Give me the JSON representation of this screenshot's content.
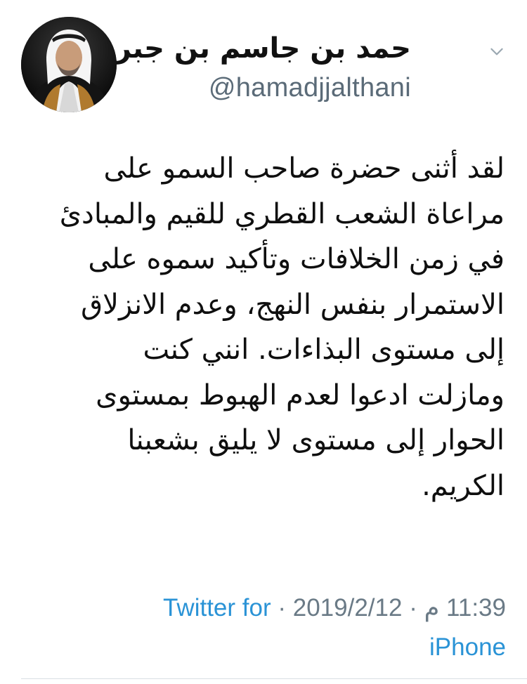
{
  "author": {
    "display_name": "حمد بن جاسم بن جبر",
    "handle": "@hamadjjalthani",
    "verified": true,
    "avatar": "profile-photo"
  },
  "tweet": {
    "lines": [
      "لقد أثنى حضرة صاحب السمو على",
      "مراعاة الشعب القطري للقيم والمبادئ",
      "في زمن الخلافات وتأكيد سموه على",
      "الاستمرار بنفس النهج، وعدم الانزلاق",
      "إلى مستوى البذاءات. انني كنت",
      "ومازلت ادعوا لعدم الهبوط بمستوى",
      "الحوار إلى مستوى لا يليق بشعبنا",
      "الكريم."
    ]
  },
  "meta": {
    "time": "11:39 م",
    "date": "2019/2/12",
    "source": "Twitter for iPhone",
    "separator": "·"
  },
  "icons": {
    "verified": "verified-badge-icon",
    "more": "chevron-down-icon"
  },
  "colors": {
    "link": "#2a93d6",
    "verified": "#1da1f2",
    "muted": "#6a7a86",
    "text": "#0f0f0f"
  }
}
